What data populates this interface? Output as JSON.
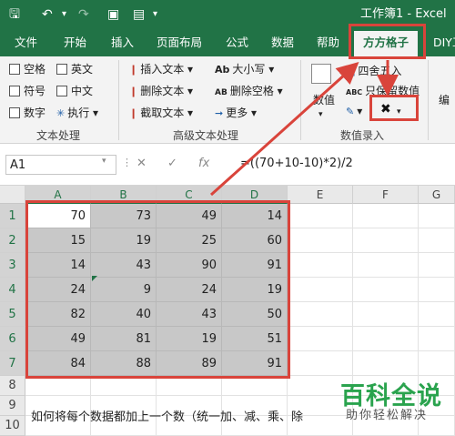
{
  "window": {
    "title": "工作簿1 - Excel"
  },
  "quick_access": {
    "save_icon": "save-icon",
    "undo_icon": "undo-icon",
    "redo_icon": "redo-icon",
    "preview_icon": "print-preview-icon"
  },
  "tabs": [
    {
      "label": "文件"
    },
    {
      "label": "开始"
    },
    {
      "label": "插入"
    },
    {
      "label": "页面布局"
    },
    {
      "label": "公式"
    },
    {
      "label": "数据"
    },
    {
      "label": "帮助"
    },
    {
      "label": "方方格子",
      "active": true
    },
    {
      "label": "DIY工"
    }
  ],
  "ribbon": {
    "text_group": {
      "checkboxes": [
        "空格",
        "英文",
        "符号",
        "中文",
        "数字"
      ],
      "execute": "执行",
      "label": "文本处理"
    },
    "advanced_group": {
      "items": [
        "插入文本",
        "删除文本",
        "截取文本",
        "大小写",
        "删除空格",
        "更多"
      ],
      "label": "高级文本处理"
    },
    "number_group": {
      "items": [
        "四舍五入",
        "只保留数值"
      ],
      "value_label": "数值",
      "label": "数值录入",
      "highlight_button_icon": "operation-icon"
    },
    "edit_label": "编"
  },
  "formula_bar": {
    "name_box": "A1",
    "fx": "fx",
    "formula": "=((70+10-10)*2)/2"
  },
  "columns": [
    "A",
    "B",
    "C",
    "D",
    "E",
    "F",
    "G"
  ],
  "rows": [
    "1",
    "2",
    "3",
    "4",
    "5",
    "6",
    "7",
    "8",
    "9",
    "10"
  ],
  "cells": [
    [
      "70",
      "73",
      "49",
      "14"
    ],
    [
      "15",
      "19",
      "25",
      "60"
    ],
    [
      "14",
      "43",
      "90",
      "91"
    ],
    [
      "24",
      "9",
      "24",
      "19"
    ],
    [
      "82",
      "40",
      "43",
      "50"
    ],
    [
      "49",
      "81",
      "19",
      "51"
    ],
    [
      "84",
      "88",
      "89",
      "91"
    ]
  ],
  "note": "如何将每个数据都加上一个数（统一加、减、乘、除",
  "watermark": {
    "title": "百科全说",
    "subtitle": "助你轻松解决"
  },
  "colors": {
    "excel_green": "#217346",
    "highlight_red": "#d9443b",
    "selection_gray": "#c8c8c8"
  }
}
